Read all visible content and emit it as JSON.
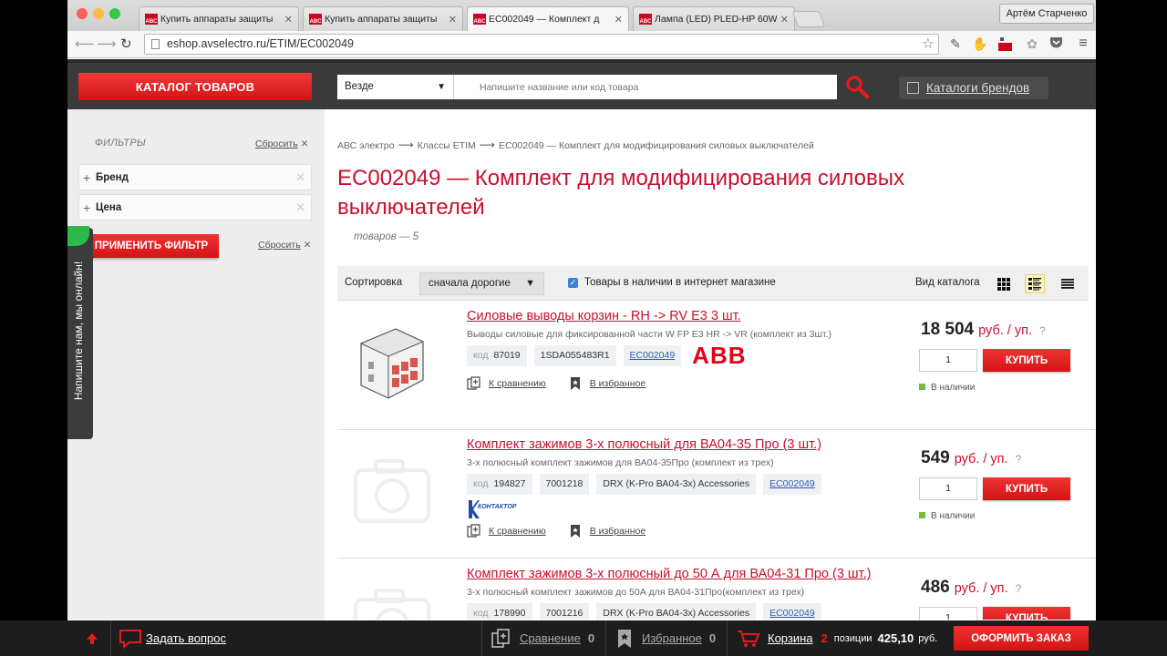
{
  "browser": {
    "tabs": [
      {
        "title": "Купить аппараты защиты",
        "favicon": "ABC"
      },
      {
        "title": "Купить аппараты защиты",
        "favicon": "ABC"
      },
      {
        "title": "EC002049 — Комплект д",
        "favicon": "ABC"
      },
      {
        "title": "Лампа (LED) PLED-HP 60W",
        "favicon": "ABC"
      }
    ],
    "user_name": "Артём Старченко",
    "url": "eshop.avselectro.ru/ETIM/EC002049",
    "extension_badge": "On"
  },
  "header": {
    "catalog_button": "КАТАЛОГ ТОВАРОВ",
    "scope_select": "Везде",
    "search_placeholder": "Напишите название или код товара",
    "brands_button": "Каталоги брендов"
  },
  "sidebar": {
    "filters_title": "ФИЛЬТРЫ",
    "reset_label": "Сбросить",
    "filters": [
      {
        "label": "Бренд"
      },
      {
        "label": "Цена"
      }
    ],
    "apply_button": "ПРИМЕНИТЬ ФИЛЬТР",
    "chat_label": "Напишите нам, мы онлайн!"
  },
  "breadcrumb": [
    "АВС электро",
    "Классы ETIM",
    "EC002049 — Комплект для модифицирования силовых выключателей"
  ],
  "page": {
    "title": "EC002049 — Комплект для модифицирования силовых выключателей",
    "count": "товаров — 5"
  },
  "sortbar": {
    "sort_label": "Сортировка",
    "sort_value": "сначала дорогие",
    "stock_label": "Товары в наличии в интернет магазине",
    "stock_checked": true,
    "view_label": "Вид каталога"
  },
  "labels": {
    "code_key": "код",
    "compare": "К сравнению",
    "favorite": "В избранное",
    "buy": "КУПИТЬ",
    "in_stock": "В наличии",
    "unit": "руб. / уп.",
    "help": "?"
  },
  "products": [
    {
      "name": "Силовые выводы корзин - RH -> RV E3 3 шт.",
      "desc": "Выводы силовые для фиксированной части W FP E3 HR -> VR (комплект из 3шт.)",
      "code": "87019",
      "article": "1SDA055483R1",
      "series": "",
      "etim": "EC002049",
      "brand": "ABB",
      "price": "18 504",
      "qty": "1"
    },
    {
      "name": "Комплект зажимов 3-х полюсный для ВА04-35 Про (3 шт.)",
      "desc": "3-х полюсный комплект зажимов для ВА04-35Про (комплект из трех)",
      "code": "194827",
      "article": "7001218",
      "series": "DRX (K-Pro ВА04-3х) Accessories",
      "etim": "EC002049",
      "brand": "КОНТАКТОР",
      "price": "549",
      "qty": "1"
    },
    {
      "name": "Комплект зажимов 3-х полюсный до 50 А для ВА04-31 Про (3 шт.)",
      "desc": "3-х полюсный комплект зажимов до 50А для ВА04-31Про(комплект из трех)",
      "code": "178990",
      "article": "7001216",
      "series": "DRX (K-Pro ВА04-3х) Accessories",
      "etim": "EC002049",
      "brand": "",
      "price": "486",
      "qty": "1"
    }
  ],
  "bottombar": {
    "ask": "Задать вопрос",
    "compare": "Сравнение",
    "compare_count": "0",
    "favorites": "Избранное",
    "favorites_count": "0",
    "cart": "Корзина",
    "cart_count": "2",
    "positions_label": "позиции",
    "cart_total": "425,10",
    "currency": "руб.",
    "checkout": "ОФОРМИТЬ ЗАКАЗ"
  },
  "colors": {
    "brand_red": "#d31414",
    "title_red": "#c8102e",
    "header_dark": "#3a3a3a",
    "link_blue": "#2b5aa8",
    "stock_green": "#6bbf3a"
  }
}
